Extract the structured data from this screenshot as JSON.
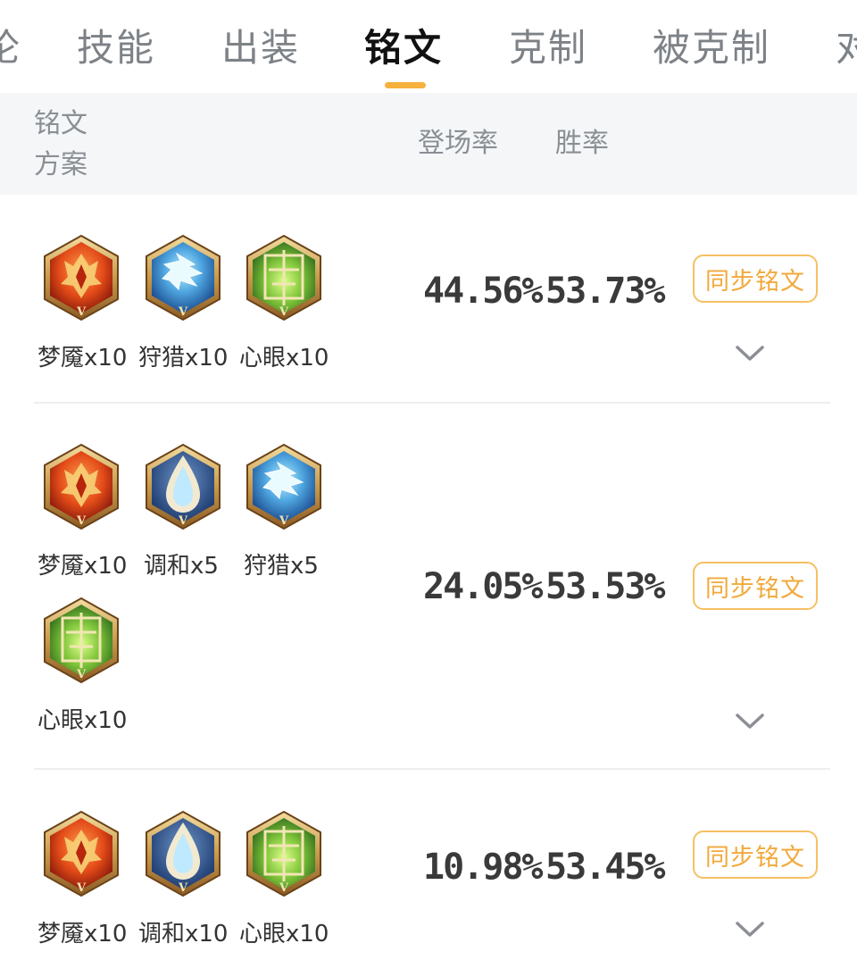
{
  "tabs": [
    "论",
    "技能",
    "出装",
    "铭文",
    "克制",
    "被克制",
    "对"
  ],
  "active_tab_index": 3,
  "header": {
    "scheme_line1": "铭文",
    "scheme_line2": "方案",
    "pick_rate": "登场率",
    "win_rate": "胜率"
  },
  "colors": {
    "accent": "#f6b13c",
    "button_text": "#f2a93b",
    "header_bg": "#f4f6f8"
  },
  "rows": [
    {
      "runes": [
        {
          "icon": "nightmare-rune-icon",
          "label": "梦魇x10"
        },
        {
          "icon": "hunt-rune-icon",
          "label": "狩猎x10"
        },
        {
          "icon": "mind-eye-rune-icon",
          "label": "心眼x10"
        }
      ],
      "pick_rate": "44.56%",
      "win_rate": "53.73%",
      "sync_label": "同步铭文"
    },
    {
      "runes": [
        {
          "icon": "nightmare-rune-icon",
          "label": "梦魇x10"
        },
        {
          "icon": "harmony-rune-icon",
          "label": "调和x5"
        },
        {
          "icon": "hunt-rune-icon",
          "label": "狩猎x5"
        },
        {
          "icon": "mind-eye-rune-icon",
          "label": "心眼x10"
        }
      ],
      "pick_rate": "24.05%",
      "win_rate": "53.53%",
      "sync_label": "同步铭文"
    },
    {
      "runes": [
        {
          "icon": "nightmare-rune-icon",
          "label": "梦魇x10"
        },
        {
          "icon": "harmony-rune-icon",
          "label": "调和x10"
        },
        {
          "icon": "mind-eye-rune-icon",
          "label": "心眼x10"
        }
      ],
      "pick_rate": "10.98%",
      "win_rate": "53.45%",
      "sync_label": "同步铭文"
    }
  ]
}
